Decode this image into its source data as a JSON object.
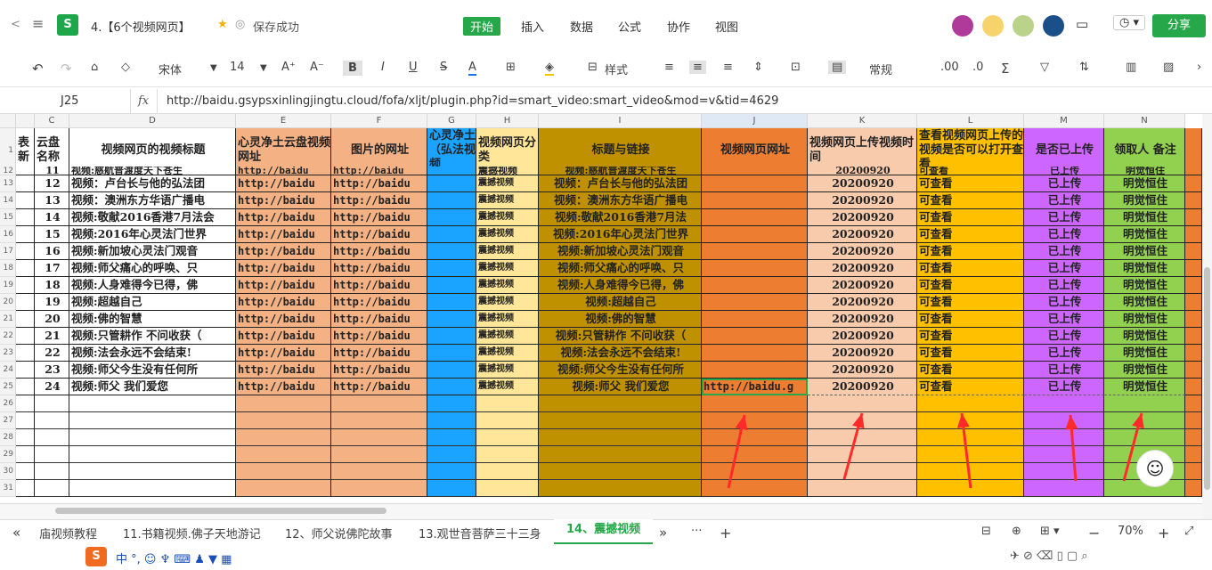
{
  "titlebar": {
    "doc_title": "4.【6个视频网页】",
    "save_status": "保存成功",
    "menus": [
      "开始",
      "插入",
      "数据",
      "公式",
      "协作",
      "视图"
    ],
    "share": "分享"
  },
  "toolbar": {
    "font": "宋体",
    "size": "14",
    "style_label": "样式",
    "format": "常规"
  },
  "formula": {
    "cell_ref": "J25",
    "fx": "fx",
    "value": "http://baidu.gsypsxinlingjingtu.cloud/fofa/xljt/plugin.php?id=smart_video:smart_video&mod=v&tid=4629"
  },
  "columns": [
    "C",
    "D",
    "E",
    "F",
    "G",
    "H",
    "I",
    "J",
    "K",
    "L",
    "M",
    "N"
  ],
  "headers": {
    "b": "表新",
    "c": "云盘名称",
    "d": "视频网页的视频标题",
    "e": "心灵净土云盘视频网址",
    "f": "图片的网址",
    "g": "心灵净土（弘法视频",
    "h": "视频网页分类",
    "i": "标题与链接",
    "j": "视频网页网址",
    "k": "视频网页上传视频时间",
    "l": "查看视频网页上传的视频是否可以打开查看",
    "m": "是否已上传",
    "n": "领取人 备注"
  },
  "rows": [
    {
      "n": "12",
      "c": "11",
      "d": "视频:慈航普渡度天下苍生",
      "e": "http://baidu",
      "f": "http://baidu",
      "h": "震撼视频",
      "i": "视频:慈航普渡度天下苍生",
      "j": "",
      "k": "20200920",
      "l": "可查看",
      "m": "已上传",
      "nn": "明觉恒住"
    },
    {
      "n": "13",
      "c": "12",
      "d": "视频：卢台长与他的弘法团",
      "e": "http://baidu",
      "f": "http://baidu",
      "h": "震撼视频",
      "i": "视频：卢台长与他的弘法团",
      "j": "",
      "k": "20200920",
      "l": "可查看",
      "m": "已上传",
      "nn": "明觉恒住"
    },
    {
      "n": "14",
      "c": "13",
      "d": "视频：澳洲东方华语广播电",
      "e": "http://baidu",
      "f": "http://baidu",
      "h": "震撼视频",
      "i": "视频：澳洲东方华语广播电",
      "j": "",
      "k": "20200920",
      "l": "可查看",
      "m": "已上传",
      "nn": "明觉恒住"
    },
    {
      "n": "15",
      "c": "14",
      "d": "视频:敬献2016香港7月法会",
      "e": "http://baidu",
      "f": "http://baidu",
      "h": "震撼视频",
      "i": "视频:敬献2016香港7月法",
      "j": "",
      "k": "20200920",
      "l": "可查看",
      "m": "已上传",
      "nn": "明觉恒住"
    },
    {
      "n": "16",
      "c": "15",
      "d": "视频:2016年心灵法门世界",
      "e": "http://baidu",
      "f": "http://baidu",
      "h": "震撼视频",
      "i": "视频:2016年心灵法门世界",
      "j": "",
      "k": "20200920",
      "l": "可查看",
      "m": "已上传",
      "nn": "明觉恒住"
    },
    {
      "n": "17",
      "c": "16",
      "d": "视频:新加坡心灵法门观音",
      "e": "http://baidu",
      "f": "http://baidu",
      "h": "震撼视频",
      "i": "视频:新加坡心灵法门观音",
      "j": "",
      "k": "20200920",
      "l": "可查看",
      "m": "已上传",
      "nn": "明觉恒住"
    },
    {
      "n": "18",
      "c": "17",
      "d": "视频:师父痛心的呼唤、只",
      "e": "http://baidu",
      "f": "http://baidu",
      "h": "震撼视频",
      "i": "视频:师父痛心的呼唤、只",
      "j": "",
      "k": "20200920",
      "l": "可查看",
      "m": "已上传",
      "nn": "明觉恒住"
    },
    {
      "n": "19",
      "c": "18",
      "d": "视频:人身难得今已得，佛",
      "e": "http://baidu",
      "f": "http://baidu",
      "h": "震撼视频",
      "i": "视频:人身难得今已得，佛",
      "j": "",
      "k": "20200920",
      "l": "可查看",
      "m": "已上传",
      "nn": "明觉恒住"
    },
    {
      "n": "20",
      "c": "19",
      "d": "视频:超越自己",
      "e": "http://baidu",
      "f": "http://baidu",
      "h": "震撼视频",
      "i": "视频:超越自己",
      "j": "",
      "k": "20200920",
      "l": "可查看",
      "m": "已上传",
      "nn": "明觉恒住"
    },
    {
      "n": "21",
      "c": "20",
      "d": "视频:佛的智慧",
      "e": "http://baidu",
      "f": "http://baidu",
      "h": "震撼视频",
      "i": "视频:佛的智慧",
      "j": "",
      "k": "20200920",
      "l": "可查看",
      "m": "已上传",
      "nn": "明觉恒住"
    },
    {
      "n": "22",
      "c": "21",
      "d": "视频:只管耕作 不问收获（",
      "e": "http://baidu",
      "f": "http://baidu",
      "h": "震撼视频",
      "i": "视频:只管耕作 不问收获（",
      "j": "",
      "k": "20200920",
      "l": "可查看",
      "m": "已上传",
      "nn": "明觉恒住"
    },
    {
      "n": "23",
      "c": "22",
      "d": "视频:法会永远不会结束!",
      "e": "http://baidu",
      "f": "http://baidu",
      "h": "震撼视频",
      "i": "视频:法会永远不会结束!",
      "j": "",
      "k": "20200920",
      "l": "可查看",
      "m": "已上传",
      "nn": "明觉恒住"
    },
    {
      "n": "24",
      "c": "23",
      "d": "视频:师父今生没有任何所",
      "e": "http://baidu",
      "f": "http://baidu",
      "h": "震撼视频",
      "i": "视频:师父今生没有任何所",
      "j": "",
      "k": "20200920",
      "l": "可查看",
      "m": "已上传",
      "nn": "明觉恒住"
    },
    {
      "n": "25",
      "c": "24",
      "d": "视频:师父 我们爱您",
      "e": "http://baidu",
      "f": "http://baidu",
      "h": "震撼视频",
      "i": "视频:师父 我们爱您",
      "j": "http://baidu.g",
      "k": "20200920",
      "l": "可查看",
      "m": "已上传",
      "nn": "明觉恒住"
    }
  ],
  "empty_rows": [
    "26",
    "27",
    "28",
    "29",
    "30",
    "31"
  ],
  "sheets": [
    "庙视频教程",
    "11.书籍视频.佛子天地游记",
    "12、师父说佛陀故事",
    "13.观世音菩萨三十三身",
    "14、震撼视频"
  ],
  "zoom": "70%",
  "colors": {
    "orange_light": "#f4b183",
    "blue": "#1aa3ff",
    "yellow_light": "#ffe699",
    "olive": "#bf9000",
    "orange": "#ed7d31",
    "peach": "#f8cbad",
    "gold": "#ffc000",
    "purple": "#cc66ff",
    "green": "#92d050",
    "accent": "#26a84a"
  }
}
